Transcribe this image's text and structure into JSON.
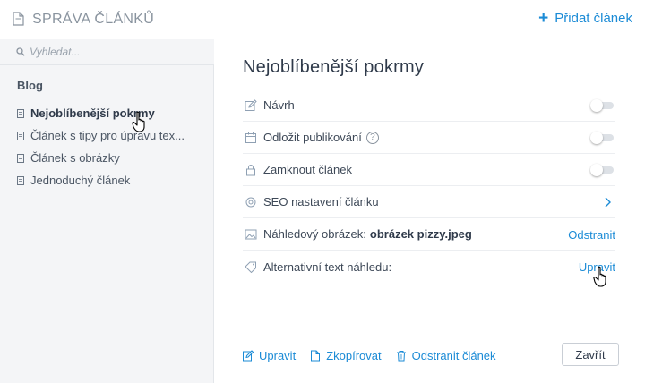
{
  "header": {
    "title": "SPRÁVA ČLÁNKŮ",
    "add_label": "Přidat článek",
    "title_icon": "document-icon"
  },
  "sidebar": {
    "search_placeholder": "Vyhledat...",
    "group_label": "Blog",
    "items": [
      {
        "label": "Nejoblíbenější pokrmy",
        "active": true
      },
      {
        "label": "Článek s tipy pro úpravu tex..."
      },
      {
        "label": "Článek s obrázky"
      },
      {
        "label": "Jednoduchý článek"
      }
    ]
  },
  "main": {
    "title": "Nejoblíbenější pokrmy",
    "rows": {
      "draft": {
        "label": "Návrh",
        "enabled": false
      },
      "schedule": {
        "label": "Odložit publikování",
        "help": "?",
        "enabled": false
      },
      "lock": {
        "label": "Zamknout článek",
        "enabled": false
      },
      "seo": {
        "label": "SEO nastavení článku"
      },
      "preview": {
        "label": "Náhledový obrázek:",
        "value": "obrázek pizzy.jpeg",
        "action": "Odstranit"
      },
      "alt": {
        "label": "Alternativní text náhledu:",
        "action": "Upravit"
      }
    },
    "footer": {
      "edit": "Upravit",
      "copy": "Zkopírovat",
      "delete": "Odstranit článek",
      "close": "Zavřít"
    }
  },
  "colors": {
    "accent": "#1b8bd6",
    "text": "#2f3a4a",
    "sidebar_bg": "#f4f5f7"
  }
}
